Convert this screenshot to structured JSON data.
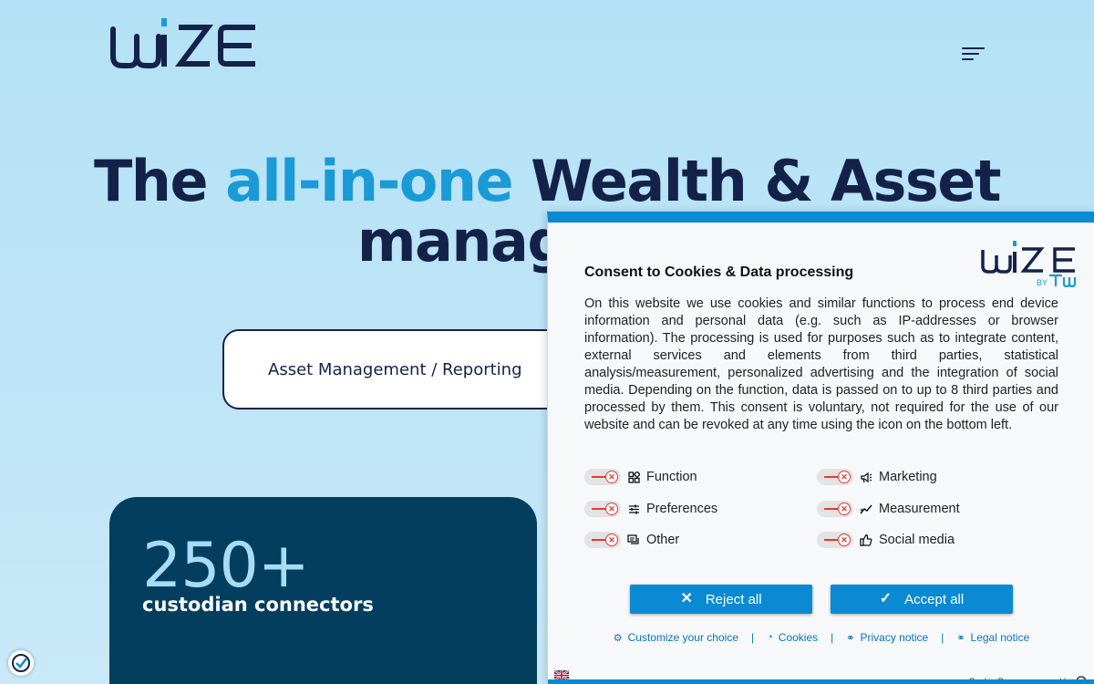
{
  "header": {
    "brand": "wize",
    "menu_icon": "hamburger-menu-icon"
  },
  "hero": {
    "title_part1": "The ",
    "title_accent": "all-in-one",
    "title_part2": " Wealth & Asset",
    "title_line2": "managemen"
  },
  "tab": {
    "label": "Asset Management / Reporting"
  },
  "stat": {
    "number": "250+",
    "label": "custodian connectors"
  },
  "consent": {
    "title": "Consent to Cookies & Data processing",
    "body": "On this website we use cookies and similar functions to process end device information and personal data (e.g. such as IP-addresses or browser information). The processing is used for purposes such as to integrate content, external services and elements from third parties, statistical analysis/measurement, personalized advertising and the integration of social media. Depending on the function, data is passed on to up to 8 third parties and processed by them. This consent is voluntary, not required for the use of our website and can be revoked at any time using the icon on the bottom left.",
    "categories": [
      {
        "label": "Function",
        "icon": "function-grid-icon",
        "enabled": false
      },
      {
        "label": "Marketing",
        "icon": "megaphone-icon",
        "enabled": false
      },
      {
        "label": "Preferences",
        "icon": "sliders-icon",
        "enabled": false
      },
      {
        "label": "Measurement",
        "icon": "chart-line-icon",
        "enabled": false
      },
      {
        "label": "Other",
        "icon": "chat-bubbles-icon",
        "enabled": false
      },
      {
        "label": "Social media",
        "icon": "thumbs-up-icon",
        "enabled": false
      }
    ],
    "reject_label": "Reject all",
    "accept_label": "Accept all",
    "links": {
      "customize": "Customize your choice",
      "cookies": "Cookies",
      "privacy": "Privacy notice",
      "legal": "Legal notice"
    },
    "powered_by": "Cookie Banner powered by",
    "accent_color": "#0a8ad2"
  }
}
